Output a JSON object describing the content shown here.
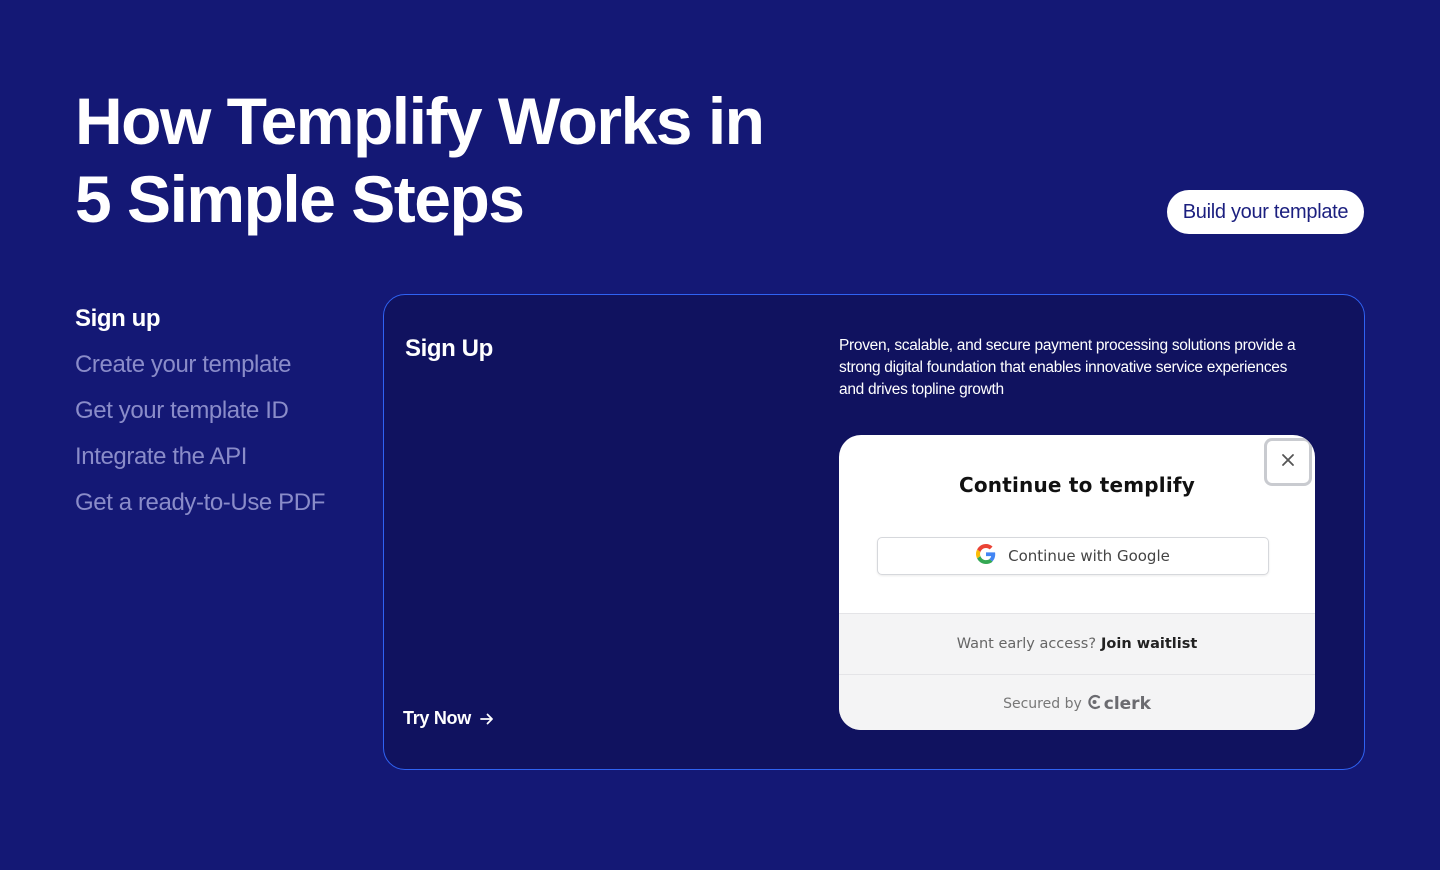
{
  "heading": {
    "line1": "How Templify Works in",
    "line2": "5 Simple Steps"
  },
  "build_button": "Build your template",
  "steps": [
    "Sign up",
    "Create your template",
    "Get your template ID",
    "Integrate the API",
    "Get a ready-to-Use PDF"
  ],
  "active_step": "Sign up",
  "card": {
    "title": "Sign Up",
    "description": "Proven, scalable, and secure payment processing solutions provide a strong digital foundation that enables innovative service experiences and drives topline growth",
    "try_now": "Try Now",
    "arrow_icon": "arrow-right-icon"
  },
  "modal": {
    "title": "Continue to templify",
    "google_button": "Continue with Google",
    "google_icon": "google-icon",
    "close_icon": "close-icon",
    "waitlist_text": "Want early access?",
    "waitlist_link": "Join waitlist",
    "secured_by": "Secured by",
    "clerk_brand": "clerk"
  },
  "colors": {
    "background": "#141875",
    "card_background": "#10125f",
    "card_border": "#2f62f3",
    "inactive_step": "#8a8cc9",
    "button_text": "#1b1f7f"
  }
}
